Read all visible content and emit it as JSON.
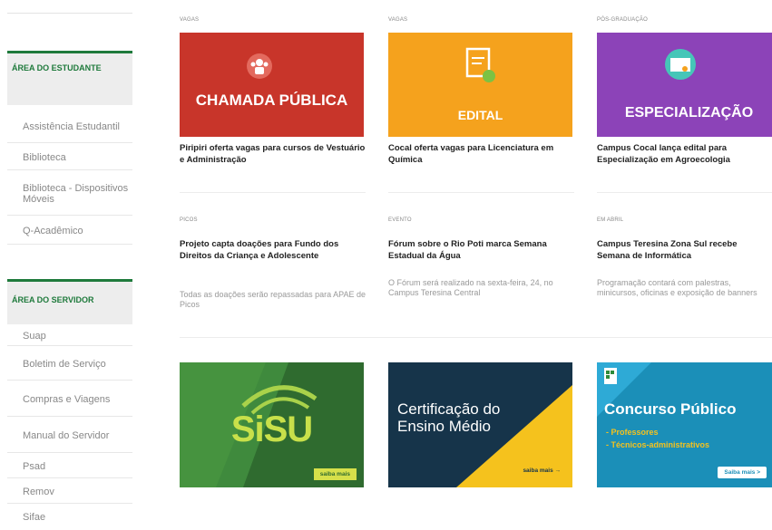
{
  "sidebar": {
    "section1": {
      "title": "ÁREA DO ESTUDANTE",
      "items": [
        {
          "label": "Assistência Estudantil"
        },
        {
          "label": "Biblioteca"
        },
        {
          "label": "Biblioteca - Dispositivos Móveis"
        },
        {
          "label": "Q-Acadêmico"
        }
      ]
    },
    "section2": {
      "title": "ÁREA DO SERVIDOR",
      "items": [
        {
          "label": "Suap"
        },
        {
          "label": "Boletim de Serviço"
        },
        {
          "label": "Compras e Viagens"
        },
        {
          "label": "Manual do Servidor"
        },
        {
          "label": "Psad"
        },
        {
          "label": "Remov"
        },
        {
          "label": "Sifae"
        }
      ]
    }
  },
  "news": [
    {
      "category": "VAGAS",
      "banner_text": "CHAMADA PÚBLICA",
      "banner_color": "#c8352a",
      "title": "Piripiri oferta vagas para cursos de Vestuário e Administração"
    },
    {
      "category": "VAGAS",
      "banner_text": "EDITAL",
      "banner_color": "#f5a21d",
      "title": "Cocal oferta vagas para Licenciatura em Química"
    },
    {
      "category": "PÓS-GRADUAÇÃO",
      "banner_text": "ESPECIALIZAÇÃO",
      "banner_color": "#8c43b8",
      "title": "Campus Cocal lança edital para Especialização em Agroecologia"
    }
  ],
  "articles": [
    {
      "category": "PICOS",
      "title": "Projeto capta doações para Fundo dos Direitos da Criança e Adolescente",
      "description": "Todas as doações serão repassadas para APAE de Picos"
    },
    {
      "category": "EVENTO",
      "title": "Fórum sobre o Rio Poti marca Semana Estadual da Água",
      "description": "O Fórum será realizado na sexta-feira, 24, no Campus Teresina Central"
    },
    {
      "category": "EM ABRIL",
      "title": "Campus Teresina Zona Sul recebe Semana de Informática",
      "description": "Programação contará com palestras, minicursos, oficinas e exposição de banners"
    }
  ],
  "banners": [
    {
      "logo_text": "SiSU",
      "button_label": "saiba mais"
    },
    {
      "heading": "Certificação do Ensino Médio",
      "button_label": "saiba mais →"
    },
    {
      "heading": "Concurso Público",
      "bullet1": "- Professores",
      "bullet2": "- Técnicos-administrativos",
      "button_label": "Saiba mais >"
    }
  ]
}
